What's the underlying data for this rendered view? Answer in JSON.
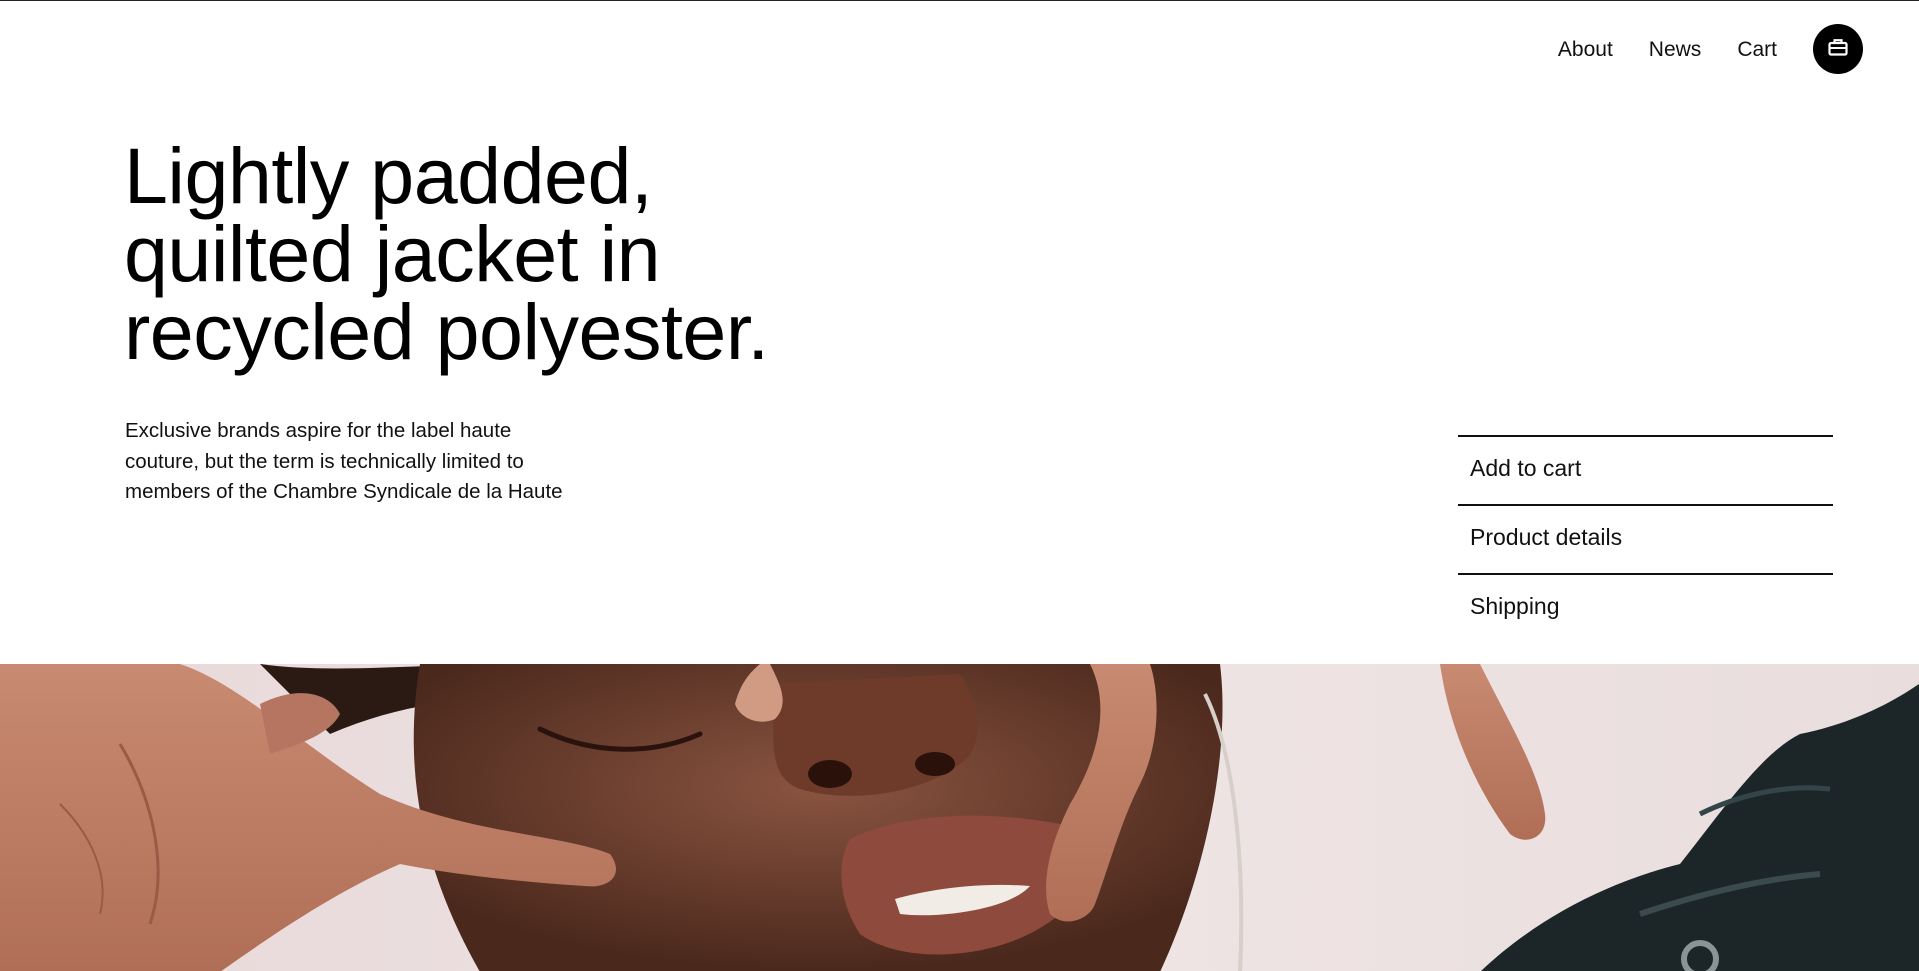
{
  "nav": {
    "items": [
      {
        "label": "About"
      },
      {
        "label": "News"
      },
      {
        "label": "Cart"
      }
    ],
    "cart_icon": "shopping-bag-icon"
  },
  "hero": {
    "headline_lines": [
      "Lightly padded,",
      "quilted jacket in",
      "recycled polyester."
    ],
    "description_lines": [
      "Exclusive brands aspire for the label haute",
      "couture, but the term is technically limited to",
      "members of the Chambre Syndicale de la Haute"
    ]
  },
  "actions": [
    {
      "label": "Add to cart"
    },
    {
      "label": "Product details"
    },
    {
      "label": "Shipping"
    }
  ],
  "colors": {
    "text": "#000000",
    "background": "#ffffff",
    "accent": "#000000"
  }
}
